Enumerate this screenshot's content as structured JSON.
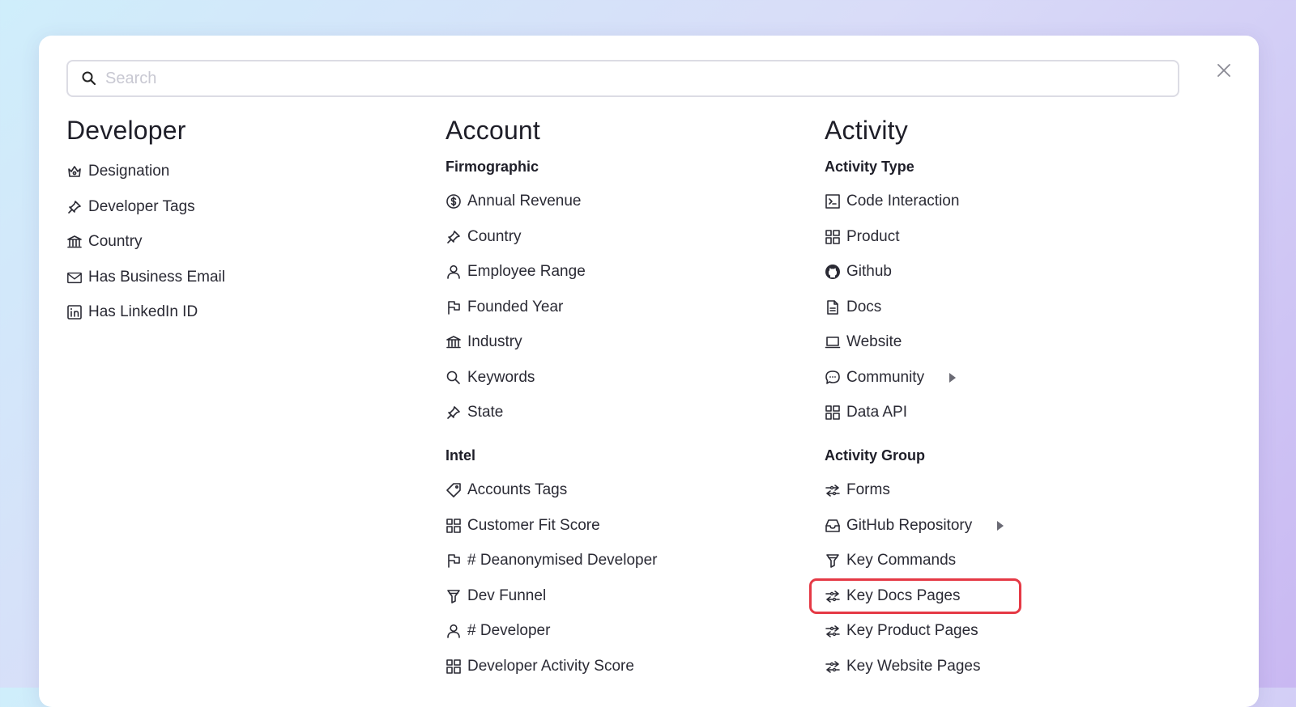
{
  "search": {
    "placeholder": "Search"
  },
  "columns": [
    {
      "title": "Developer",
      "groups": [
        {
          "title": "",
          "items": [
            {
              "label": "Designation",
              "icon": "crown-icon"
            },
            {
              "label": "Developer Tags",
              "icon": "pin-icon"
            },
            {
              "label": "Country",
              "icon": "bank-icon"
            },
            {
              "label": "Has Business Email",
              "icon": "mail-icon"
            },
            {
              "label": "Has LinkedIn ID",
              "icon": "linkedin-icon"
            }
          ]
        }
      ]
    },
    {
      "title": "Account",
      "groups": [
        {
          "title": "Firmographic",
          "items": [
            {
              "label": "Annual Revenue",
              "icon": "dollar-circle-icon"
            },
            {
              "label": "Country",
              "icon": "pin-icon"
            },
            {
              "label": "Employee Range",
              "icon": "user-icon"
            },
            {
              "label": "Founded Year",
              "icon": "flag-icon"
            },
            {
              "label": "Industry",
              "icon": "bank-icon"
            },
            {
              "label": "Keywords",
              "icon": "search-icon"
            },
            {
              "label": "State",
              "icon": "pin-icon"
            }
          ]
        },
        {
          "title": "Intel",
          "items": [
            {
              "label": "Accounts Tags",
              "icon": "tag-icon"
            },
            {
              "label": "Customer Fit Score",
              "icon": "grid-icon"
            },
            {
              "label": "# Deanonymised Developer",
              "icon": "flag-icon"
            },
            {
              "label": "Dev Funnel",
              "icon": "funnel-icon"
            },
            {
              "label": "# Developer",
              "icon": "user-icon"
            },
            {
              "label": "Developer Activity Score",
              "icon": "grid-icon"
            }
          ]
        }
      ]
    },
    {
      "title": "Activity",
      "groups": [
        {
          "title": "Activity Type",
          "items": [
            {
              "label": "Code Interaction",
              "icon": "terminal-icon"
            },
            {
              "label": "Product",
              "icon": "grid-icon"
            },
            {
              "label": "Github",
              "icon": "github-icon"
            },
            {
              "label": "Docs",
              "icon": "document-icon"
            },
            {
              "label": "Website",
              "icon": "laptop-icon"
            },
            {
              "label": "Community",
              "icon": "chat-icon",
              "submenu": true
            },
            {
              "label": "Data API",
              "icon": "grid-icon"
            }
          ]
        },
        {
          "title": "Activity Group",
          "items": [
            {
              "label": "Forms",
              "icon": "arrows-icon"
            },
            {
              "label": "GitHub Repository",
              "icon": "inbox-icon",
              "submenu": true
            },
            {
              "label": "Key Commands",
              "icon": "funnel-icon"
            },
            {
              "label": "Key Docs Pages",
              "icon": "arrows-icon",
              "highlighted": true
            },
            {
              "label": "Key Product Pages",
              "icon": "arrows-icon"
            },
            {
              "label": "Key Website Pages",
              "icon": "arrows-icon"
            }
          ]
        }
      ]
    }
  ],
  "colors": {
    "highlight": "#e53945",
    "text": "#2a2a34",
    "heading": "#1e1e28"
  }
}
